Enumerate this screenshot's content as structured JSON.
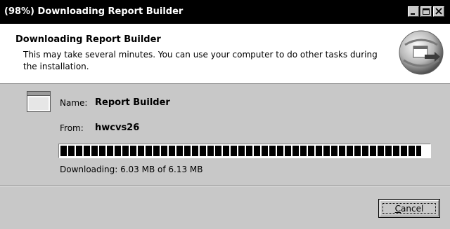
{
  "window": {
    "title": "(98%) Downloading Report Builder",
    "controls": [
      "minimize-icon",
      "maximize-icon",
      "close-icon"
    ]
  },
  "header": {
    "title": "Downloading Report Builder",
    "description": "This may take several minutes. You can use your computer to do other tasks during the installation.",
    "icon": "installer-globe-icon"
  },
  "details": {
    "name_label": "Name:",
    "name_value": "Report Builder",
    "from_label": "From:",
    "from_value": "hwcvs26"
  },
  "progress": {
    "percent": 98,
    "status": "Downloading: 6.03 MB of 6.13 MB"
  },
  "buttons": {
    "cancel_first": "C",
    "cancel_rest": "ancel"
  }
}
